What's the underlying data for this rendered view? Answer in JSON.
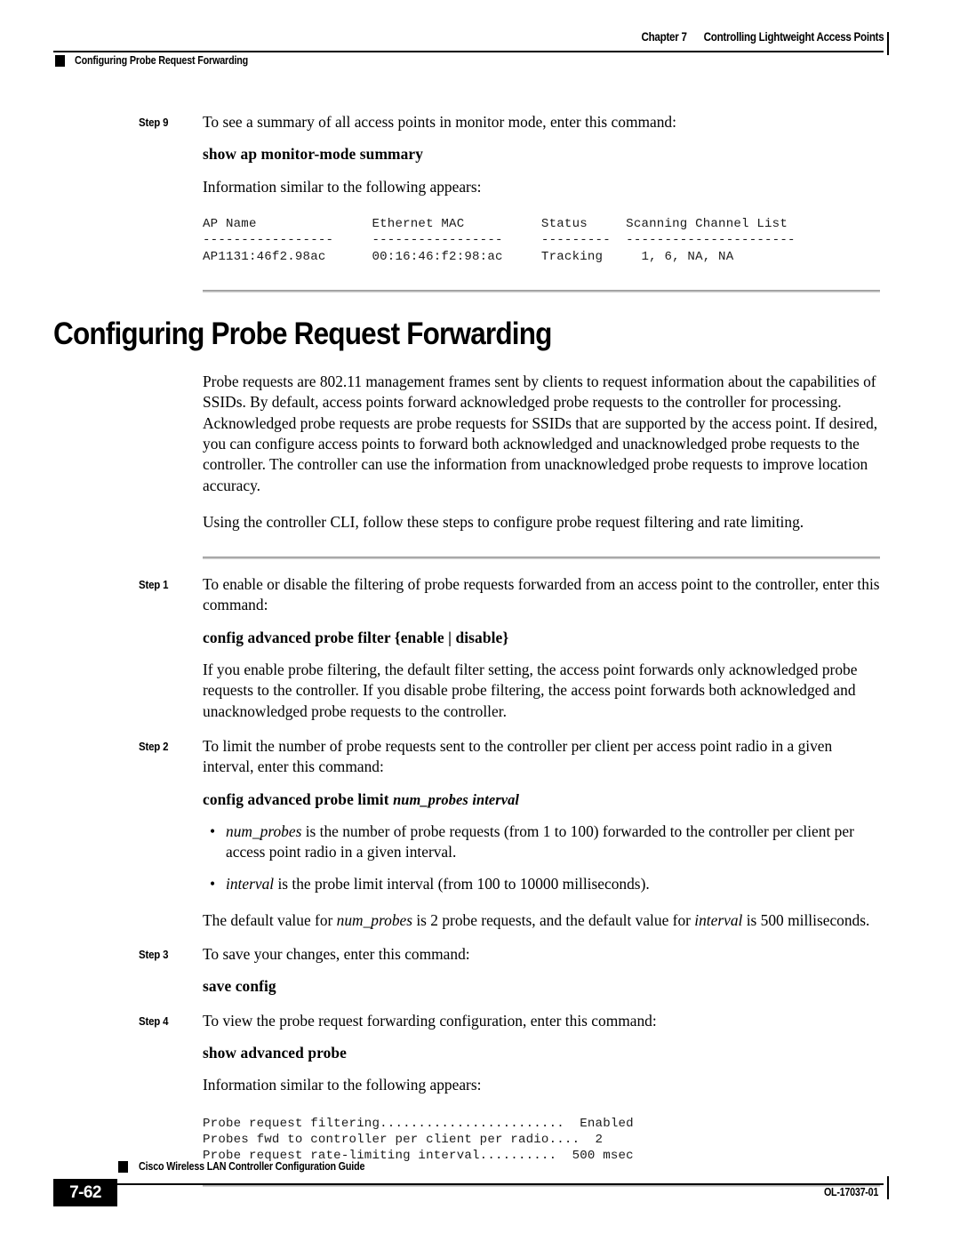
{
  "header": {
    "chapter_label": "Chapter 7",
    "chapter_title": "Controlling Lightweight Access Points",
    "section_label": "Configuring Probe Request Forwarding"
  },
  "step9": {
    "label": "Step 9",
    "intro": "To see a summary of all access points in monitor mode, enter this command:",
    "command": "show ap monitor-mode summary",
    "note": "Information similar to the following appears:",
    "cli_output": "AP Name               Ethernet MAC          Status     Scanning Channel List\n-----------------     -----------------     ---------  ----------------------\nAP1131:46f2.98ac      00:16:46:f2:98:ac     Tracking     1, 6, NA, NA"
  },
  "section": {
    "title": "Configuring Probe Request Forwarding",
    "paragraph1": "Probe requests are 802.11 management frames sent by clients to request information about the capabilities of SSIDs. By default, access points forward acknowledged probe requests to the controller for processing. Acknowledged probe requests are probe requests for SSIDs that are supported by the access point. If desired, you can configure access points to forward both acknowledged and unacknowledged probe requests to the controller. The controller can use the information from unacknowledged probe requests to improve location accuracy.",
    "paragraph2": "Using the controller CLI, follow these steps to configure probe request filtering and rate limiting."
  },
  "step1": {
    "label": "Step 1",
    "intro": "To enable or disable the filtering of probe requests forwarded from an access point to the controller, enter this command:",
    "command_prefix": "config advanced probe filter",
    "command_args": "{enable | disable}",
    "explanation": "If you enable probe filtering, the default filter setting, the access point forwards only acknowledged probe requests to the controller. If you disable probe filtering, the access point forwards both acknowledged and unacknowledged probe requests to the controller."
  },
  "step2": {
    "label": "Step 2",
    "intro": "To limit the number of probe requests sent to the controller per client per access point radio in a given interval, enter this command:",
    "command_prefix": "config advanced probe limit",
    "command_var1": "num_probes",
    "command_var2": "interval",
    "bullets": [
      {
        "marker": "•",
        "var": "num_probes",
        "text": " is the number of probe requests (from 1 to 100) forwarded to the controller per client per access point radio in a given interval."
      },
      {
        "marker": "•",
        "var": "interval",
        "text": " is the probe limit interval (from 100 to 10000 milliseconds)."
      }
    ],
    "default_text_a": "The default value for ",
    "default_var_a": "num_probes",
    "default_text_b": " is 2 probe requests, and the default value for ",
    "default_var_b": "interval",
    "default_text_c": " is 500 milliseconds."
  },
  "step3": {
    "label": "Step 3",
    "intro": "To save your changes, enter this command:",
    "command": "save config"
  },
  "step4": {
    "label": "Step 4",
    "intro": "To view the probe request forwarding configuration, enter this command:",
    "command": "show advanced probe",
    "note": "Information similar to the following appears:",
    "cli_output": "Probe request filtering........................  Enabled\nProbes fwd to controller per client per radio....  2\nProbe request rate-limiting interval..........  500 msec"
  },
  "footer": {
    "page_number": "7-62",
    "guide_title": "Cisco Wireless LAN Controller Configuration Guide",
    "doc_id": "OL-17037-01"
  }
}
